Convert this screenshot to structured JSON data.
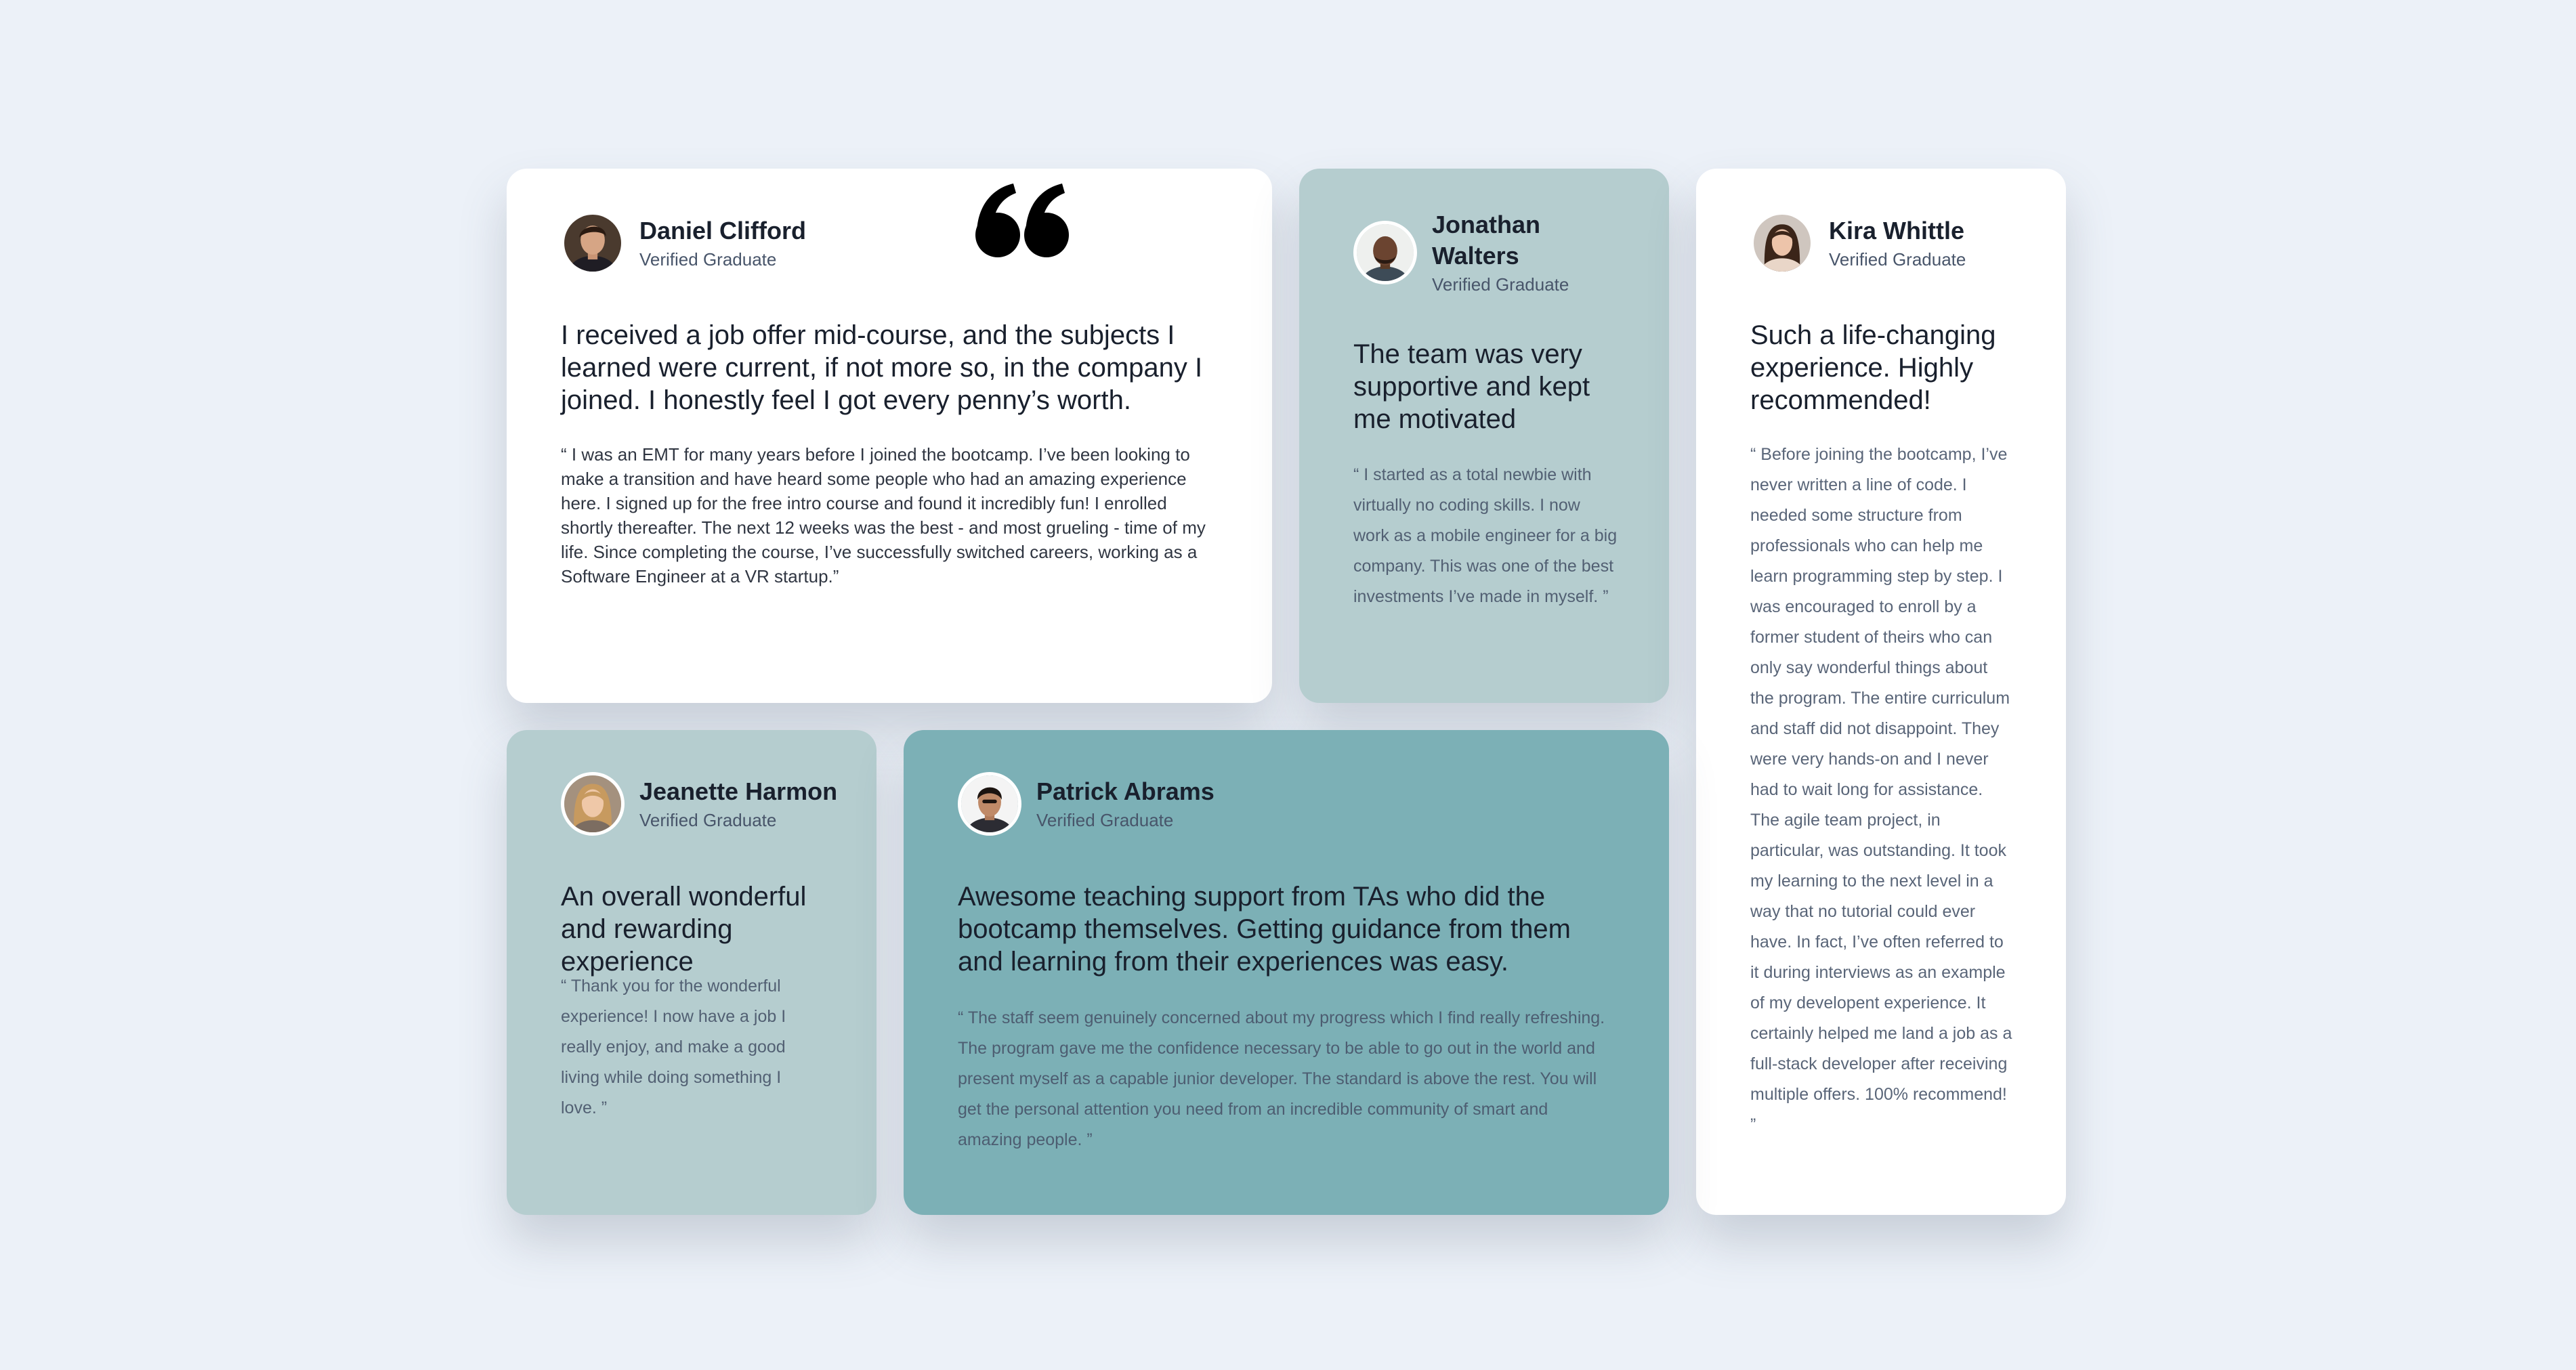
{
  "testimonials": [
    {
      "name": "Daniel Clifford",
      "status": "Verified Graduate",
      "headline": "I received a job offer mid-course, and the subjects I learned were current, if not more so, in the company I joined. I honestly feel I got every penny’s worth.",
      "quote": "“ I was an EMT for many years before I joined the bootcamp. I’ve been looking to make a transition and have heard some people who had an amazing experience here. I signed up for the free intro course and found it incredibly fun! I enrolled shortly thereafter. The next 12 weeks was the best - and most grueling - time of my life. Since completing the course, I’ve successfully switched careers, working as a Software Engineer at a VR startup.”"
    },
    {
      "name": "Jonathan Walters",
      "status": "Verified Graduate",
      "headline": "The team was very supportive and kept me motivated",
      "quote": "“ I started as a total newbie with virtually no coding skills. I now work as a mobile engineer for a big company. This was one of the best investments I’ve made in myself. ”"
    },
    {
      "name": "Kira Whittle",
      "status": "Verified Graduate",
      "headline": "Such a life-changing experience. Highly recommended!",
      "quote": "“ Before joining the bootcamp, I’ve never written a line of code. I needed some structure from professionals who can help me learn programming step by step. I was encouraged to enroll by a former student of theirs who can only say wonderful things about the program. The entire curriculum and staff did not disappoint. They were very hands-on and I never had to wait long for assistance. The agile team project, in particular, was outstanding. It took my learning to the next level in a way that no tutorial could ever have. In fact, I’ve often referred to it during interviews as an example of my developent experience. It certainly helped me land a job as a full-stack developer after receiving multiple offers. 100% recommend! ”"
    },
    {
      "name": "Jeanette Harmon",
      "status": "Verified Graduate",
      "headline": "An overall wonderful and rewarding experience",
      "quote": "“ Thank you for the wonderful experience! I now have a job I really enjoy, and make a good living while doing something I love. ”"
    },
    {
      "name": "Patrick Abrams",
      "status": "Verified Graduate",
      "headline": "Awesome teaching support from TAs who did the bootcamp themselves. Getting guidance from them and learning from their experiences was easy.",
      "quote": "“ The staff seem genuinely concerned about my progress which I find really refreshing. The program gave me the confidence necessary to be able to go out in the world and present myself as a capable junior developer. The standard is above the rest. You will get the personal attention you need from an incredible community of smart and amazing people. ”"
    }
  ],
  "colors": {
    "page_background": "#ecf1f8",
    "card_white": "#ffffff",
    "card_mint": "#b5cdcf",
    "card_teal": "#7cb0b6",
    "text_dark": "#19202d",
    "text_muted": "#48556a"
  },
  "icons": {
    "quote_decoration": "quotation-mark-icon"
  }
}
